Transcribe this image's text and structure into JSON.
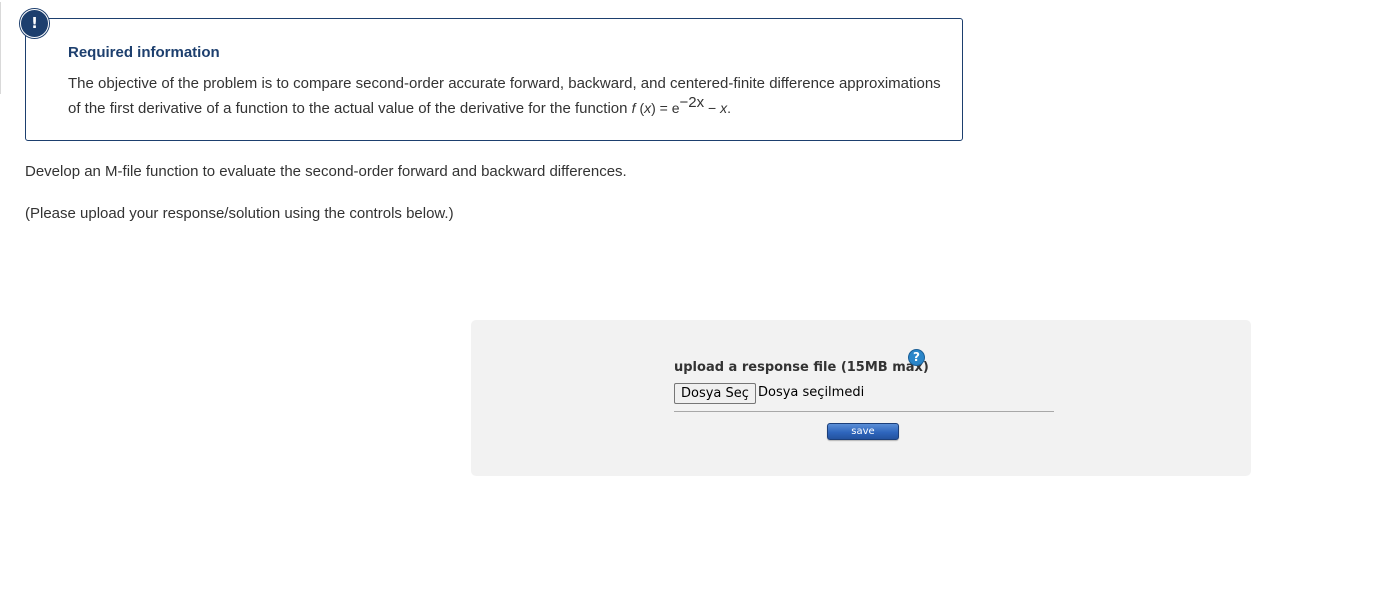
{
  "info": {
    "badge_icon": "!",
    "title": "Required information",
    "text": "The objective of the problem is to compare second-order accurate forward, backward, and centered-finite difference approximations of the first derivative of a function to the actual value of the derivative for the function",
    "function_lhs_name": "f",
    "function_lhs_open": " (",
    "function_lhs_var": "x",
    "function_lhs_close": ") = e",
    "function_exponent": "−2x",
    "function_rhs_minus": " − ",
    "function_rhs_var": "x",
    "function_end": "."
  },
  "question": {
    "text": "Develop an M-file function to evaluate the second-order forward and backward differences.",
    "upload_note": "(Please upload your response/solution using the controls below.)"
  },
  "upload": {
    "label": "upload a response file (15MB max)",
    "help_icon": "?",
    "choose_button": "Dosya Seç",
    "status": "Dosya seçilmedi",
    "save_label": "save"
  },
  "colors": {
    "accent": "#1d3f6e",
    "panel_bg": "#f2f2f2",
    "help_icon": "#2b86c9",
    "save_button": "#2f66bd"
  },
  "icons": {
    "badge": "exclamation-icon",
    "help": "question-mark-icon"
  }
}
